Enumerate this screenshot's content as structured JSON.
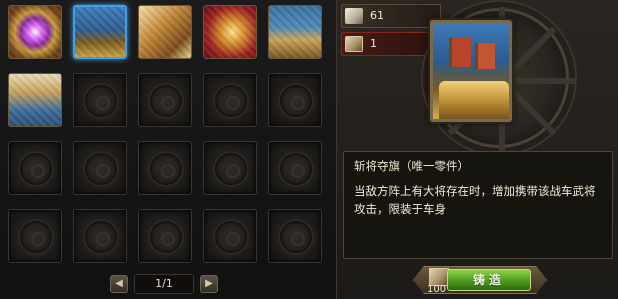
{
  "inventory": {
    "slots": [
      {
        "item": "vortex-gem",
        "filled": true,
        "selected": false
      },
      {
        "item": "flagship-banner",
        "filled": true,
        "selected": true
      },
      {
        "item": "golden-dragon",
        "filled": true,
        "selected": false
      },
      {
        "item": "red-gold-armor",
        "filled": true,
        "selected": false
      },
      {
        "item": "fortress-cannon",
        "filled": true,
        "selected": false
      },
      {
        "item": "army-formation",
        "filled": true,
        "selected": false
      },
      {
        "item": "",
        "filled": false
      },
      {
        "item": "",
        "filled": false
      },
      {
        "item": "",
        "filled": false
      },
      {
        "item": "",
        "filled": false
      },
      {
        "item": "",
        "filled": false
      },
      {
        "item": "",
        "filled": false
      },
      {
        "item": "",
        "filled": false
      },
      {
        "item": "",
        "filled": false
      },
      {
        "item": "",
        "filled": false
      },
      {
        "item": "",
        "filled": false
      },
      {
        "item": "",
        "filled": false
      },
      {
        "item": "",
        "filled": false
      },
      {
        "item": "",
        "filled": false
      },
      {
        "item": "",
        "filled": false
      }
    ]
  },
  "pagination": {
    "label": "1/1",
    "prev_icon": "chevron-left-icon",
    "next_icon": "chevron-right-icon"
  },
  "resources": {
    "silver": {
      "icon": "silver-ingot-icon",
      "value": "61"
    },
    "material": {
      "icon": "material-scroll-icon",
      "value": "1"
    }
  },
  "selected_item": {
    "title": "斩将夺旗（唯一零件）",
    "description": "当敌方阵上有大将存在时，增加携带该战车武将攻击，限装于车身"
  },
  "forge": {
    "label": "铸造",
    "cost": "100",
    "cost_icon": "material-scroll-icon"
  },
  "colors": {
    "selection": "#3ea0e8",
    "forge_button": "#4f9a1e"
  }
}
